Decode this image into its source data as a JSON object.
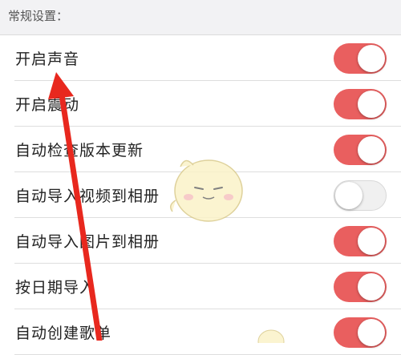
{
  "section": {
    "title": "常规设置："
  },
  "settings": [
    {
      "label": "开启声音",
      "enabled": true
    },
    {
      "label": "开启震动",
      "enabled": true
    },
    {
      "label": "自动检查版本更新",
      "enabled": true
    },
    {
      "label": "自动导入视频到相册",
      "enabled": false
    },
    {
      "label": "自动导入图片到相册",
      "enabled": true
    },
    {
      "label": "按日期导入",
      "enabled": true
    },
    {
      "label": "自动创建歌单",
      "enabled": true
    }
  ],
  "colors": {
    "toggle_on": "#e95f5f",
    "toggle_off": "#f0f0f0",
    "annotation_arrow": "#e8281e",
    "section_bg": "#f2f2f4"
  },
  "icons": {
    "annotation": "red-arrow",
    "watermark": "mascot-watermark"
  }
}
